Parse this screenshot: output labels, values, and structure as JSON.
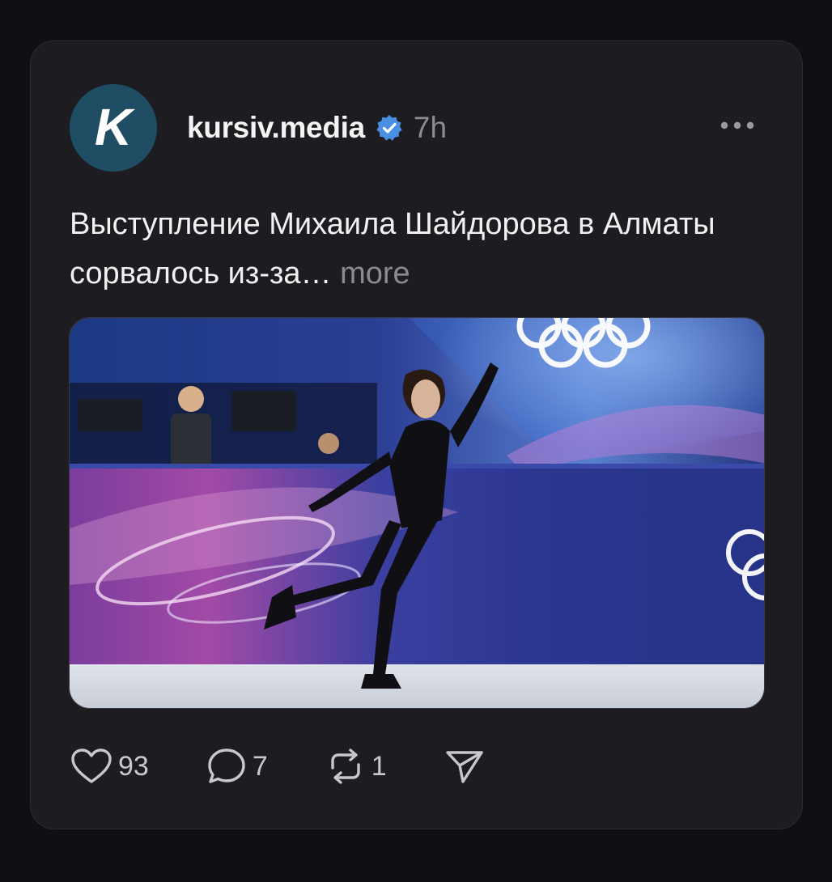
{
  "post": {
    "username": "kursiv.media",
    "verified": true,
    "time": "7h",
    "text": "Выступление Михаила Шайдорова в Алматы сорвалось из-за…",
    "more_label": "more",
    "image_alt": "Figure skater performing on ice at the Olympics"
  },
  "avatar": {
    "letter": "K",
    "color": "#1f4d63"
  },
  "actions": {
    "likes": "93",
    "comments": "7",
    "reposts": "1"
  },
  "colors": {
    "background": "#0f1015",
    "card": "#1d1d21",
    "verified": "#4a90e2",
    "muted": "#8a8a90"
  },
  "icons": [
    "logo-avatar",
    "verified-icon",
    "more-icon",
    "heart-icon",
    "comment-icon",
    "repost-icon",
    "share-icon"
  ]
}
